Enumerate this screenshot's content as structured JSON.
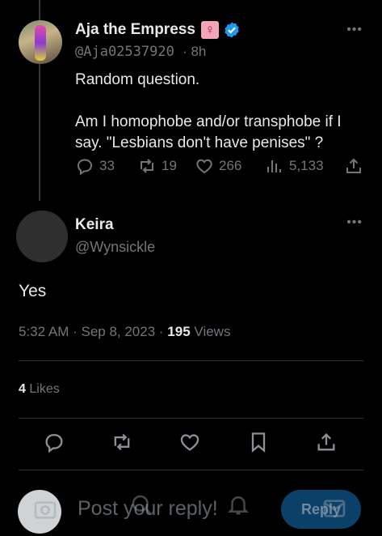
{
  "original_tweet": {
    "author_name": "Aja the Empress",
    "badge_symbol": "♀",
    "handle": "@Aja02537920",
    "time": "· 8h",
    "text": "Random question.\n\nAm I homophobe and/or transphobe if I say. \"Lesbians don't have penises\" ?",
    "more": "•••",
    "replies": "33",
    "reposts": "19",
    "likes": "266",
    "views": "5,133"
  },
  "reply_tweet": {
    "author_name": "Keira",
    "handle": "@Wynsickle",
    "more": "•••",
    "text": "Yes",
    "timestamp": "5:32 AM · Sep 8, 2023 ·",
    "view_count": "195",
    "views_label": "Views",
    "like_count": "4",
    "likes_label": "Likes"
  },
  "composer": {
    "placeholder": "Post your reply!",
    "reply_button": "Reply"
  },
  "colors": {
    "background": "#000000",
    "text": "#e7e9ea",
    "muted": "#71767b",
    "accent": "#1d9bf0"
  },
  "icons": [
    "reply-icon",
    "repost-icon",
    "like-icon",
    "views-icon",
    "share-icon",
    "bookmark-icon",
    "verified-icon",
    "more-icon",
    "image-icon",
    "search-icon",
    "bell-icon",
    "mail-icon"
  ]
}
